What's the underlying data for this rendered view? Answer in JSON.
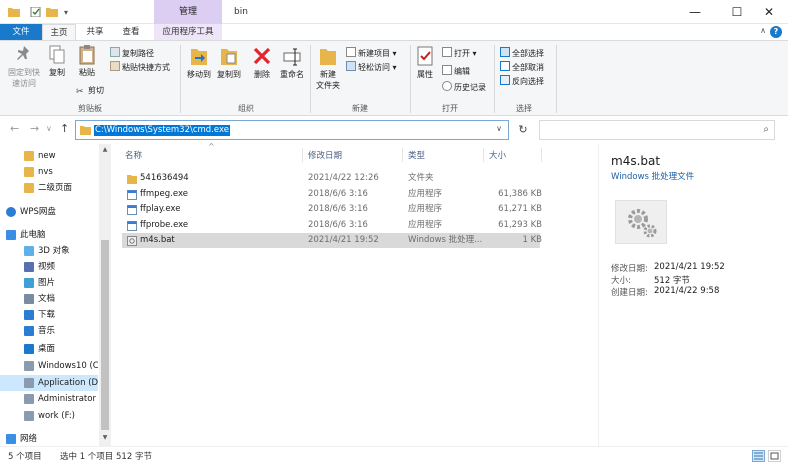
{
  "titlebar": {
    "contextual_tab": "管理",
    "title": "bin",
    "minimize": "—",
    "maximize": "☐",
    "close": "✕",
    "dropdown_glyph": "▾"
  },
  "tabs": {
    "file": "文件",
    "home": "主页",
    "share": "共享",
    "view": "查看",
    "app_tools": "应用程序工具",
    "collapse_glyph": "∧",
    "help_glyph": "?"
  },
  "ribbon": {
    "clipboard": {
      "pin": "固定到快\n速访问",
      "copy": "复制",
      "paste": "粘贴",
      "copy_path": "复制路径",
      "paste_shortcut": "粘贴快捷方式",
      "cut": "剪切",
      "label": "剪贴板"
    },
    "organize": {
      "move_to": "移动到",
      "copy_to": "复制到",
      "delete": "删除",
      "rename": "重命名",
      "label": "组织"
    },
    "new": {
      "new_folder": "新建\n文件夹",
      "new_item": "新建项目",
      "easy_access": "轻松访问",
      "label": "新建"
    },
    "open": {
      "properties": "属性",
      "open": "打开",
      "edit": "编辑",
      "history": "历史记录",
      "label": "打开"
    },
    "select": {
      "select_all": "全部选择",
      "select_none": "全部取消",
      "invert": "反向选择",
      "label": "选择"
    }
  },
  "navbar": {
    "back": "←",
    "forward": "→",
    "recent": "∨",
    "up": "↑",
    "address": "C:\\Windows\\System32\\cmd.exe",
    "dropdown": "∨",
    "refresh": "↻",
    "search_placeholder": "",
    "search_icon": "⌕"
  },
  "nav_pane": {
    "items": [
      {
        "label": "new",
        "icon": "folder-icon"
      },
      {
        "label": "nvs",
        "icon": "folder-icon"
      },
      {
        "label": "二级页面",
        "icon": "folder-icon"
      },
      {
        "label": "WPS网盘",
        "icon": "cloud-icon"
      },
      {
        "label": "此电脑",
        "icon": "computer-icon"
      },
      {
        "label": "3D 对象",
        "icon": "cube-icon"
      },
      {
        "label": "视频",
        "icon": "video-icon"
      },
      {
        "label": "图片",
        "icon": "picture-icon"
      },
      {
        "label": "文档",
        "icon": "document-icon"
      },
      {
        "label": "下载",
        "icon": "download-icon"
      },
      {
        "label": "音乐",
        "icon": "music-icon"
      },
      {
        "label": "桌面",
        "icon": "desktop-icon"
      },
      {
        "label": "Windows10 (C:",
        "icon": "drive-icon"
      },
      {
        "label": "Application (D:",
        "icon": "drive-icon"
      },
      {
        "label": "Administrator (",
        "icon": "drive-icon"
      },
      {
        "label": "work (F:)",
        "icon": "drive-icon"
      },
      {
        "label": "网络",
        "icon": "network-icon"
      }
    ],
    "scroll_up": "▲",
    "scroll_down": "▼"
  },
  "file_list": {
    "columns": {
      "name": "名称",
      "date": "修改日期",
      "type": "类型",
      "size": "大小"
    },
    "sort_glyph": "^",
    "rows": [
      {
        "name": "541636494",
        "date": "2021/4/22 12:26",
        "type": "文件夹",
        "size": "",
        "icon": "folder-icon"
      },
      {
        "name": "ffmpeg.exe",
        "date": "2018/6/6 3:16",
        "type": "应用程序",
        "size": "61,386 KB",
        "icon": "exe-icon"
      },
      {
        "name": "ffplay.exe",
        "date": "2018/6/6 3:16",
        "type": "应用程序",
        "size": "61,271 KB",
        "icon": "exe-icon"
      },
      {
        "name": "ffprobe.exe",
        "date": "2018/6/6 3:16",
        "type": "应用程序",
        "size": "61,293 KB",
        "icon": "exe-icon"
      },
      {
        "name": "m4s.bat",
        "date": "2021/4/21 19:52",
        "type": "Windows 批处理...",
        "size": "1 KB",
        "icon": "bat-icon"
      }
    ]
  },
  "details": {
    "name": "m4s.bat",
    "type": "Windows 批处理文件",
    "modified_label": "修改日期:",
    "modified": "2021/4/21 19:52",
    "size_label": "大小:",
    "size": "512 字节",
    "created_label": "创建日期:",
    "created": "2021/4/22 9:58"
  },
  "status": {
    "count": "5 个项目",
    "selection": "选中 1 个项目  512 字节"
  }
}
